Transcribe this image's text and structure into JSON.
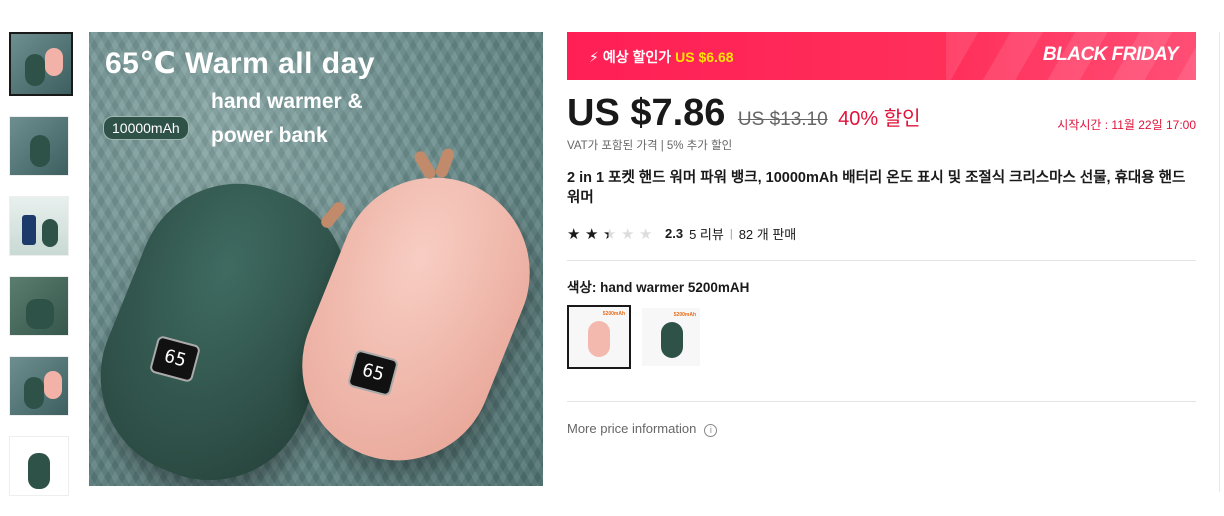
{
  "gallery": {
    "main_image": {
      "headline": "65℃ Warm all day",
      "subline_1": "hand warmer &",
      "subline_2": "power bank",
      "badge": "10000mAh",
      "display_green": "65",
      "display_pink": "65"
    }
  },
  "banner": {
    "prefix": "예상 할인가",
    "price": "US $6.68",
    "campaign": "BLACK FRIDAY",
    "color": "#ff2f5a"
  },
  "price": {
    "current": "US $7.86",
    "original": "US $13.10",
    "discount": "40% 할인",
    "start_time": "시작시간 :  11월 22일 17:00",
    "vat_note": "VAT가 포함된 가격 | 5% 추가 할인"
  },
  "product": {
    "title": "2 in 1 포켓 핸드 워머 파워 뱅크, 10000mAh 배터리 온도 표시 및 조절식 크리스마스 선물, 휴대용 핸드 워머"
  },
  "rating": {
    "stars": 2.3,
    "score": "2.3",
    "reviews": "5 리뷰",
    "sold": "82 개 판매"
  },
  "variant": {
    "label": "색상: hand warmer 5200mAH",
    "options": [
      {
        "color": "#f4b9ae",
        "selected": true
      },
      {
        "color": "#2f5248",
        "selected": false
      }
    ]
  },
  "more_price": {
    "label": "More price information",
    "icon": "info-icon"
  }
}
